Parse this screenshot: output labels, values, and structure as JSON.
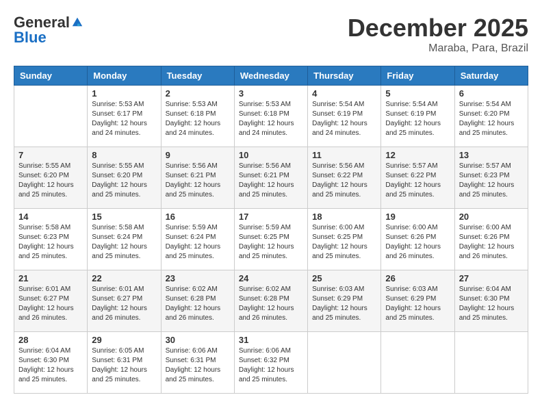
{
  "header": {
    "logo_general": "General",
    "logo_blue": "Blue",
    "month": "December 2025",
    "location": "Maraba, Para, Brazil"
  },
  "days_of_week": [
    "Sunday",
    "Monday",
    "Tuesday",
    "Wednesday",
    "Thursday",
    "Friday",
    "Saturday"
  ],
  "weeks": [
    [
      {
        "day": "",
        "info": ""
      },
      {
        "day": "1",
        "info": "Sunrise: 5:53 AM\nSunset: 6:17 PM\nDaylight: 12 hours\nand 24 minutes."
      },
      {
        "day": "2",
        "info": "Sunrise: 5:53 AM\nSunset: 6:18 PM\nDaylight: 12 hours\nand 24 minutes."
      },
      {
        "day": "3",
        "info": "Sunrise: 5:53 AM\nSunset: 6:18 PM\nDaylight: 12 hours\nand 24 minutes."
      },
      {
        "day": "4",
        "info": "Sunrise: 5:54 AM\nSunset: 6:19 PM\nDaylight: 12 hours\nand 24 minutes."
      },
      {
        "day": "5",
        "info": "Sunrise: 5:54 AM\nSunset: 6:19 PM\nDaylight: 12 hours\nand 25 minutes."
      },
      {
        "day": "6",
        "info": "Sunrise: 5:54 AM\nSunset: 6:20 PM\nDaylight: 12 hours\nand 25 minutes."
      }
    ],
    [
      {
        "day": "7",
        "info": "Sunrise: 5:55 AM\nSunset: 6:20 PM\nDaylight: 12 hours\nand 25 minutes."
      },
      {
        "day": "8",
        "info": "Sunrise: 5:55 AM\nSunset: 6:20 PM\nDaylight: 12 hours\nand 25 minutes."
      },
      {
        "day": "9",
        "info": "Sunrise: 5:56 AM\nSunset: 6:21 PM\nDaylight: 12 hours\nand 25 minutes."
      },
      {
        "day": "10",
        "info": "Sunrise: 5:56 AM\nSunset: 6:21 PM\nDaylight: 12 hours\nand 25 minutes."
      },
      {
        "day": "11",
        "info": "Sunrise: 5:56 AM\nSunset: 6:22 PM\nDaylight: 12 hours\nand 25 minutes."
      },
      {
        "day": "12",
        "info": "Sunrise: 5:57 AM\nSunset: 6:22 PM\nDaylight: 12 hours\nand 25 minutes."
      },
      {
        "day": "13",
        "info": "Sunrise: 5:57 AM\nSunset: 6:23 PM\nDaylight: 12 hours\nand 25 minutes."
      }
    ],
    [
      {
        "day": "14",
        "info": "Sunrise: 5:58 AM\nSunset: 6:23 PM\nDaylight: 12 hours\nand 25 minutes."
      },
      {
        "day": "15",
        "info": "Sunrise: 5:58 AM\nSunset: 6:24 PM\nDaylight: 12 hours\nand 25 minutes."
      },
      {
        "day": "16",
        "info": "Sunrise: 5:59 AM\nSunset: 6:24 PM\nDaylight: 12 hours\nand 25 minutes."
      },
      {
        "day": "17",
        "info": "Sunrise: 5:59 AM\nSunset: 6:25 PM\nDaylight: 12 hours\nand 25 minutes."
      },
      {
        "day": "18",
        "info": "Sunrise: 6:00 AM\nSunset: 6:25 PM\nDaylight: 12 hours\nand 25 minutes."
      },
      {
        "day": "19",
        "info": "Sunrise: 6:00 AM\nSunset: 6:26 PM\nDaylight: 12 hours\nand 26 minutes."
      },
      {
        "day": "20",
        "info": "Sunrise: 6:00 AM\nSunset: 6:26 PM\nDaylight: 12 hours\nand 26 minutes."
      }
    ],
    [
      {
        "day": "21",
        "info": "Sunrise: 6:01 AM\nSunset: 6:27 PM\nDaylight: 12 hours\nand 26 minutes."
      },
      {
        "day": "22",
        "info": "Sunrise: 6:01 AM\nSunset: 6:27 PM\nDaylight: 12 hours\nand 26 minutes."
      },
      {
        "day": "23",
        "info": "Sunrise: 6:02 AM\nSunset: 6:28 PM\nDaylight: 12 hours\nand 26 minutes."
      },
      {
        "day": "24",
        "info": "Sunrise: 6:02 AM\nSunset: 6:28 PM\nDaylight: 12 hours\nand 26 minutes."
      },
      {
        "day": "25",
        "info": "Sunrise: 6:03 AM\nSunset: 6:29 PM\nDaylight: 12 hours\nand 25 minutes."
      },
      {
        "day": "26",
        "info": "Sunrise: 6:03 AM\nSunset: 6:29 PM\nDaylight: 12 hours\nand 25 minutes."
      },
      {
        "day": "27",
        "info": "Sunrise: 6:04 AM\nSunset: 6:30 PM\nDaylight: 12 hours\nand 25 minutes."
      }
    ],
    [
      {
        "day": "28",
        "info": "Sunrise: 6:04 AM\nSunset: 6:30 PM\nDaylight: 12 hours\nand 25 minutes."
      },
      {
        "day": "29",
        "info": "Sunrise: 6:05 AM\nSunset: 6:31 PM\nDaylight: 12 hours\nand 25 minutes."
      },
      {
        "day": "30",
        "info": "Sunrise: 6:06 AM\nSunset: 6:31 PM\nDaylight: 12 hours\nand 25 minutes."
      },
      {
        "day": "31",
        "info": "Sunrise: 6:06 AM\nSunset: 6:32 PM\nDaylight: 12 hours\nand 25 minutes."
      },
      {
        "day": "",
        "info": ""
      },
      {
        "day": "",
        "info": ""
      },
      {
        "day": "",
        "info": ""
      }
    ]
  ]
}
